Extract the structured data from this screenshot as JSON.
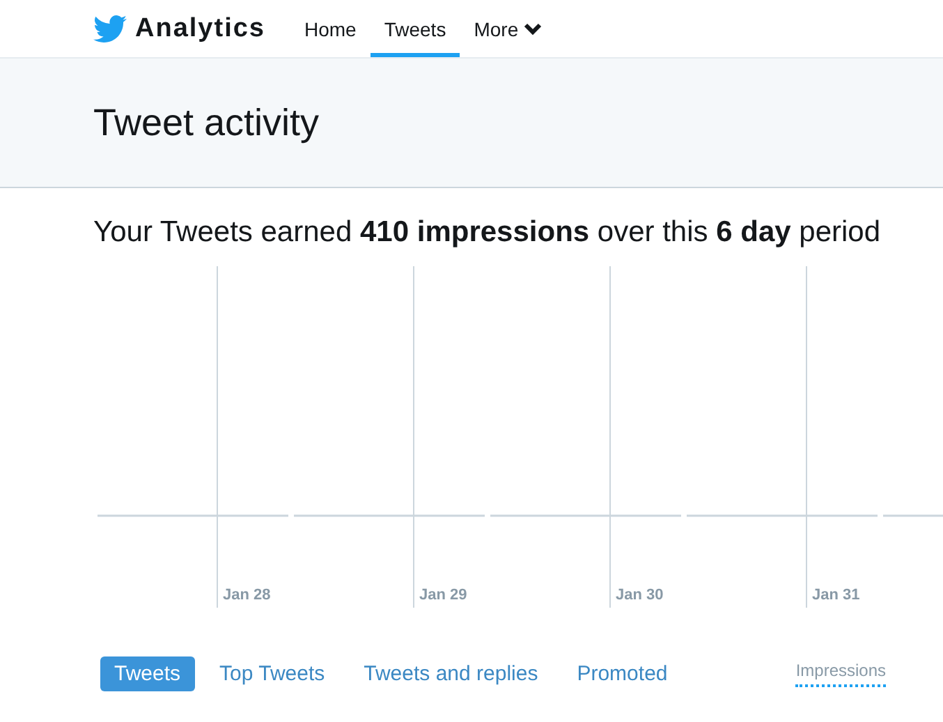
{
  "brand": {
    "name": "Analytics"
  },
  "nav": [
    {
      "label": "Home",
      "selected": false
    },
    {
      "label": "Tweets",
      "selected": true
    },
    {
      "label": "More",
      "selected": false
    }
  ],
  "page_title": "Tweet activity",
  "summary": "Your Tweets earned **410 impressions** over this **6 day** period",
  "chart": {
    "date_labels": [
      "Jan 28",
      "Jan 29",
      "Jan 30",
      "Jan 31"
    ]
  },
  "tabs": [
    {
      "label": "Tweets",
      "selected": true
    },
    {
      "label": "Top Tweets",
      "selected": false
    },
    {
      "label": "Tweets and replies",
      "selected": false
    },
    {
      "label": "Promoted",
      "selected": false
    }
  ],
  "column_header": "Impressions"
}
